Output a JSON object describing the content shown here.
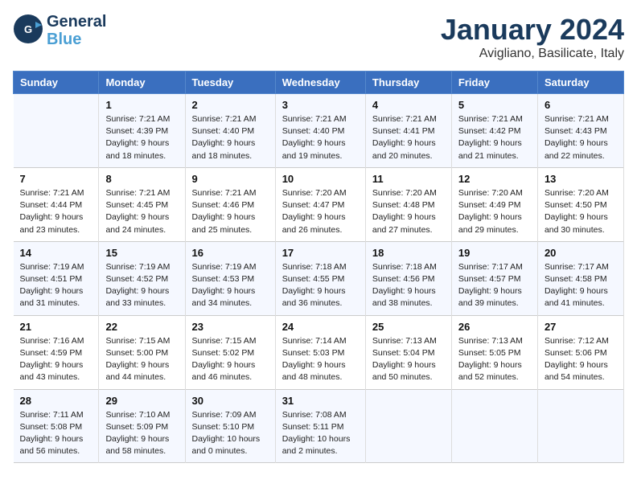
{
  "header": {
    "logo_line1": "General",
    "logo_line2": "Blue",
    "month": "January 2024",
    "location": "Avigliano, Basilicate, Italy"
  },
  "days_of_week": [
    "Sunday",
    "Monday",
    "Tuesday",
    "Wednesday",
    "Thursday",
    "Friday",
    "Saturday"
  ],
  "weeks": [
    [
      {
        "day": "",
        "info": ""
      },
      {
        "day": "1",
        "info": "Sunrise: 7:21 AM\nSunset: 4:39 PM\nDaylight: 9 hours\nand 18 minutes."
      },
      {
        "day": "2",
        "info": "Sunrise: 7:21 AM\nSunset: 4:40 PM\nDaylight: 9 hours\nand 18 minutes."
      },
      {
        "day": "3",
        "info": "Sunrise: 7:21 AM\nSunset: 4:40 PM\nDaylight: 9 hours\nand 19 minutes."
      },
      {
        "day": "4",
        "info": "Sunrise: 7:21 AM\nSunset: 4:41 PM\nDaylight: 9 hours\nand 20 minutes."
      },
      {
        "day": "5",
        "info": "Sunrise: 7:21 AM\nSunset: 4:42 PM\nDaylight: 9 hours\nand 21 minutes."
      },
      {
        "day": "6",
        "info": "Sunrise: 7:21 AM\nSunset: 4:43 PM\nDaylight: 9 hours\nand 22 minutes."
      }
    ],
    [
      {
        "day": "7",
        "info": "Sunrise: 7:21 AM\nSunset: 4:44 PM\nDaylight: 9 hours\nand 23 minutes."
      },
      {
        "day": "8",
        "info": "Sunrise: 7:21 AM\nSunset: 4:45 PM\nDaylight: 9 hours\nand 24 minutes."
      },
      {
        "day": "9",
        "info": "Sunrise: 7:21 AM\nSunset: 4:46 PM\nDaylight: 9 hours\nand 25 minutes."
      },
      {
        "day": "10",
        "info": "Sunrise: 7:20 AM\nSunset: 4:47 PM\nDaylight: 9 hours\nand 26 minutes."
      },
      {
        "day": "11",
        "info": "Sunrise: 7:20 AM\nSunset: 4:48 PM\nDaylight: 9 hours\nand 27 minutes."
      },
      {
        "day": "12",
        "info": "Sunrise: 7:20 AM\nSunset: 4:49 PM\nDaylight: 9 hours\nand 29 minutes."
      },
      {
        "day": "13",
        "info": "Sunrise: 7:20 AM\nSunset: 4:50 PM\nDaylight: 9 hours\nand 30 minutes."
      }
    ],
    [
      {
        "day": "14",
        "info": "Sunrise: 7:19 AM\nSunset: 4:51 PM\nDaylight: 9 hours\nand 31 minutes."
      },
      {
        "day": "15",
        "info": "Sunrise: 7:19 AM\nSunset: 4:52 PM\nDaylight: 9 hours\nand 33 minutes."
      },
      {
        "day": "16",
        "info": "Sunrise: 7:19 AM\nSunset: 4:53 PM\nDaylight: 9 hours\nand 34 minutes."
      },
      {
        "day": "17",
        "info": "Sunrise: 7:18 AM\nSunset: 4:55 PM\nDaylight: 9 hours\nand 36 minutes."
      },
      {
        "day": "18",
        "info": "Sunrise: 7:18 AM\nSunset: 4:56 PM\nDaylight: 9 hours\nand 38 minutes."
      },
      {
        "day": "19",
        "info": "Sunrise: 7:17 AM\nSunset: 4:57 PM\nDaylight: 9 hours\nand 39 minutes."
      },
      {
        "day": "20",
        "info": "Sunrise: 7:17 AM\nSunset: 4:58 PM\nDaylight: 9 hours\nand 41 minutes."
      }
    ],
    [
      {
        "day": "21",
        "info": "Sunrise: 7:16 AM\nSunset: 4:59 PM\nDaylight: 9 hours\nand 43 minutes."
      },
      {
        "day": "22",
        "info": "Sunrise: 7:15 AM\nSunset: 5:00 PM\nDaylight: 9 hours\nand 44 minutes."
      },
      {
        "day": "23",
        "info": "Sunrise: 7:15 AM\nSunset: 5:02 PM\nDaylight: 9 hours\nand 46 minutes."
      },
      {
        "day": "24",
        "info": "Sunrise: 7:14 AM\nSunset: 5:03 PM\nDaylight: 9 hours\nand 48 minutes."
      },
      {
        "day": "25",
        "info": "Sunrise: 7:13 AM\nSunset: 5:04 PM\nDaylight: 9 hours\nand 50 minutes."
      },
      {
        "day": "26",
        "info": "Sunrise: 7:13 AM\nSunset: 5:05 PM\nDaylight: 9 hours\nand 52 minutes."
      },
      {
        "day": "27",
        "info": "Sunrise: 7:12 AM\nSunset: 5:06 PM\nDaylight: 9 hours\nand 54 minutes."
      }
    ],
    [
      {
        "day": "28",
        "info": "Sunrise: 7:11 AM\nSunset: 5:08 PM\nDaylight: 9 hours\nand 56 minutes."
      },
      {
        "day": "29",
        "info": "Sunrise: 7:10 AM\nSunset: 5:09 PM\nDaylight: 9 hours\nand 58 minutes."
      },
      {
        "day": "30",
        "info": "Sunrise: 7:09 AM\nSunset: 5:10 PM\nDaylight: 10 hours\nand 0 minutes."
      },
      {
        "day": "31",
        "info": "Sunrise: 7:08 AM\nSunset: 5:11 PM\nDaylight: 10 hours\nand 2 minutes."
      },
      {
        "day": "",
        "info": ""
      },
      {
        "day": "",
        "info": ""
      },
      {
        "day": "",
        "info": ""
      }
    ]
  ]
}
